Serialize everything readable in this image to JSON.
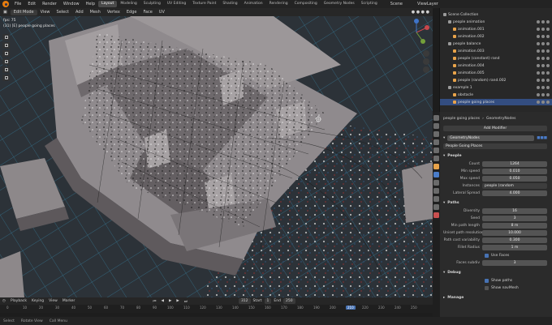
{
  "menu": {
    "items": [
      "File",
      "Edit",
      "Render",
      "Window",
      "Help"
    ],
    "workspaces": [
      "Layout",
      "Modeling",
      "Sculpting",
      "UV Editing",
      "Texture Paint",
      "Shading",
      "Animation",
      "Rendering",
      "Compositing",
      "Geometry Nodes",
      "Scripting"
    ],
    "scene": "Scene",
    "view_layer": "ViewLayer"
  },
  "viewport_header": {
    "mode": "Edit Mode",
    "items": [
      "View",
      "Select",
      "Add",
      "Mesh",
      "Vertex",
      "Edge",
      "Face",
      "UV"
    ],
    "options": "Options"
  },
  "viewport": {
    "info_line1": "fps: 75",
    "info_line2": "(31) [E] people going places"
  },
  "outliner": {
    "rows": [
      {
        "label": "Scene Collection",
        "indent": 0,
        "color": "#9b9b9b"
      },
      {
        "label": "people animation",
        "indent": 1,
        "color": "#9b9b9b"
      },
      {
        "label": "animation.001",
        "indent": 2,
        "color": "#e8a34a"
      },
      {
        "label": "animation.002",
        "indent": 2,
        "color": "#e8a34a"
      },
      {
        "label": "people balance",
        "indent": 1,
        "color": "#9b9b9b"
      },
      {
        "label": "animation.003",
        "indent": 2,
        "color": "#e8a34a"
      },
      {
        "label": "people (constant) rand",
        "indent": 2,
        "color": "#e8a34a"
      },
      {
        "label": "animation.004",
        "indent": 2,
        "color": "#e8a34a"
      },
      {
        "label": "animation.005",
        "indent": 2,
        "color": "#e8a34a"
      },
      {
        "label": "people (random) rand.002",
        "indent": 2,
        "color": "#e8a34a"
      },
      {
        "label": "example 1",
        "indent": 1,
        "color": "#9b9b9b"
      },
      {
        "label": "obstacle",
        "indent": 2,
        "color": "#e8a34a"
      },
      {
        "label": "people going places",
        "indent": 2,
        "color": "#e8a34a",
        "selected": true
      }
    ]
  },
  "properties": {
    "breadcrumb_object": "people going places",
    "breadcrumb_modifier": "GeometryNodes",
    "add_modifier": "Add Modifier",
    "modifier_name": "GeometryNodes",
    "node_group": "People Going Places",
    "section_people": "People",
    "people_fields": [
      {
        "label": "Count",
        "value": "1264"
      },
      {
        "label": "Min speed",
        "value": "0.010"
      },
      {
        "label": "Max speed",
        "value": "0.050"
      },
      {
        "label": "Instances",
        "value": "people (random"
      },
      {
        "label": "Lateral Spread",
        "value": "4.000"
      }
    ],
    "section_paths": "Paths",
    "paths_fields": [
      {
        "label": "Diversity",
        "value": "16"
      },
      {
        "label": "Seed",
        "value": "3"
      },
      {
        "label": "Min path length",
        "value": "8 m"
      },
      {
        "label": "Uniset path resolution",
        "value": "10.000"
      },
      {
        "label": "Path cost variability",
        "value": "0.300"
      },
      {
        "label": "Fillet Radius",
        "value": "1 m"
      }
    ],
    "use_faces": "Use Faces",
    "faces subdiv_label": "Faces subdiv",
    "faces_subdiv_value": "3",
    "section_debug": "Debug",
    "show_paths": "Show paths",
    "show_navmesh": "Show navMesh",
    "section_manage": "Manage"
  },
  "timeline": {
    "items": [
      "Playback",
      "Keying",
      "View",
      "Marker"
    ],
    "current_frame": "312",
    "start_label": "Start",
    "start_value": "1",
    "end_label": "End",
    "end_value": "250",
    "ticks": [
      "0",
      "10",
      "20",
      "30",
      "40",
      "50",
      "60",
      "70",
      "80",
      "90",
      "100",
      "110",
      "120",
      "130",
      "140",
      "150",
      "160",
      "170",
      "180",
      "190",
      "200",
      "210",
      "220",
      "230",
      "240",
      "250"
    ]
  },
  "status_bar": {
    "left": "Select",
    "mid": "Rotate View",
    "right": "Call Menu"
  },
  "colors": {
    "accent_orange": "#e87d0d",
    "selection_blue": "#334d80",
    "grid_cyan": "#3aa9d6"
  }
}
